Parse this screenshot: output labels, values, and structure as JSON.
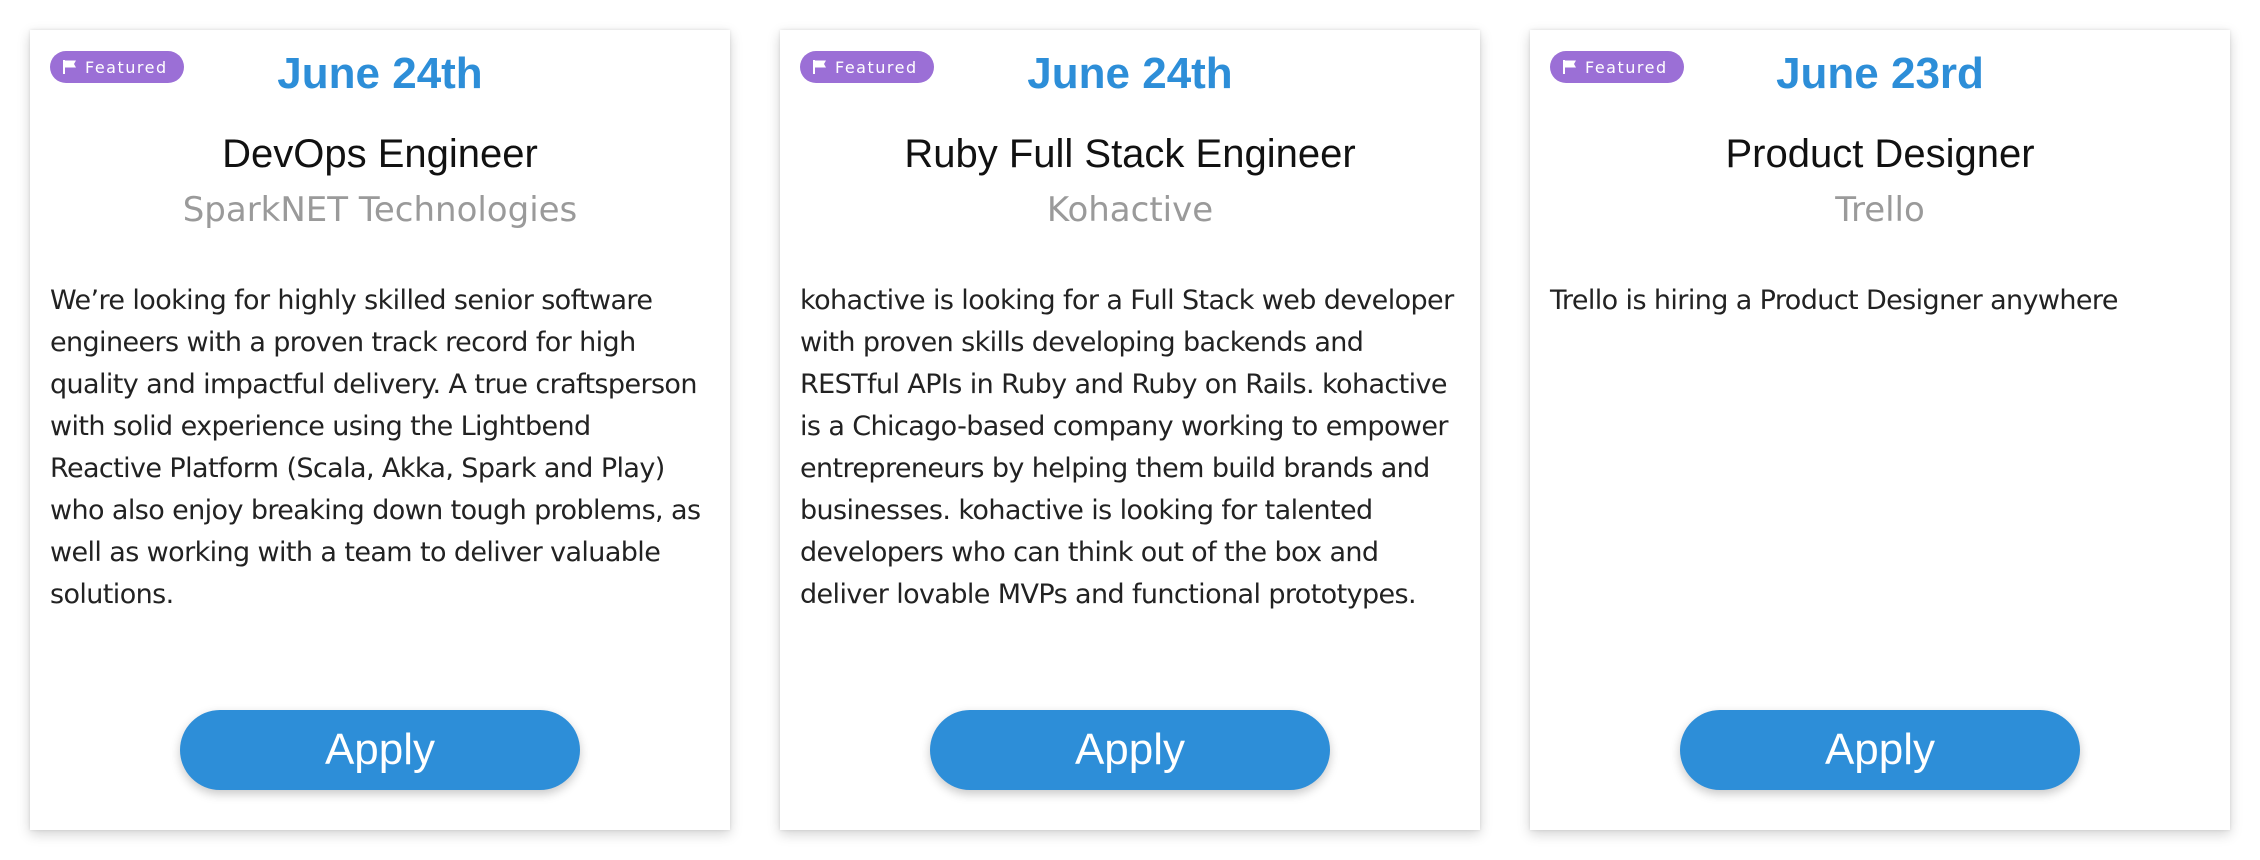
{
  "colors": {
    "accent": "#2d8ed8",
    "badge": "#9b6fd6",
    "company_text": "#9a9a9a"
  },
  "cards": [
    {
      "badge": {
        "icon": "flag-icon",
        "label": "Featured"
      },
      "date": "June 24th",
      "title": "DevOps Engineer",
      "company": "SparkNET Technologies",
      "description": "We’re looking for highly skilled senior software engineers with a proven track record for high quality and impactful delivery. A true craftsperson with solid experience using the Lightbend Reactive Platform (Scala, Akka, Spark and Play) who also enjoy breaking down tough problems, as well as working with a team to deliver valuable solutions.",
      "apply_label": "Apply"
    },
    {
      "badge": {
        "icon": "flag-icon",
        "label": "Featured"
      },
      "date": "June 24th",
      "title": "Ruby Full Stack Engineer",
      "company": "Kohactive",
      "description": "kohactive is looking for a Full Stack web developer with proven skills developing backends and RESTful APIs in Ruby and Ruby on Rails. kohactive is a Chicago-based company working to empower entrepreneurs by helping them build brands and businesses. kohactive is looking for talented developers who can think out of the box and deliver lovable MVPs and functional prototypes.",
      "apply_label": "Apply"
    },
    {
      "badge": {
        "icon": "flag-icon",
        "label": "Featured"
      },
      "date": "June 23rd",
      "title": "Product Designer",
      "company": "Trello",
      "description": "Trello is hiring a Product Designer anywhere",
      "apply_label": "Apply"
    }
  ]
}
